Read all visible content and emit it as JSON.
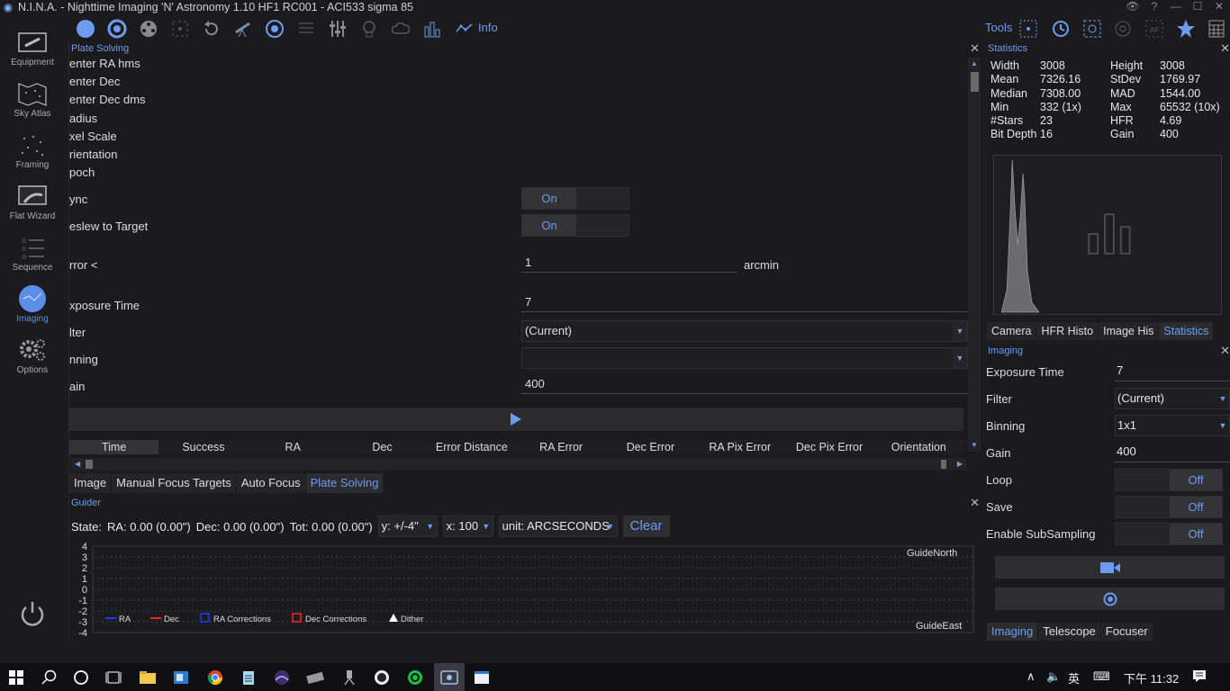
{
  "window": {
    "title": "N.I.N.A. - Nighttime Imaging 'N' Astronomy 1.10 HF1 RC001  -  ACI533 sigma 85"
  },
  "nav": {
    "items": [
      {
        "label": "Equipment"
      },
      {
        "label": "Sky Atlas"
      },
      {
        "label": "Framing"
      },
      {
        "label": "Flat Wizard"
      },
      {
        "label": "Sequence"
      },
      {
        "label": "Imaging"
      },
      {
        "label": "Options"
      }
    ],
    "active": "Imaging"
  },
  "toolbar": {
    "info_label": "Info",
    "tools_label": "Tools"
  },
  "plate_solving": {
    "header": "Plate Solving",
    "rows": {
      "center_ra": "enter RA hms",
      "center_dec": "enter Dec",
      "center_dec_dms": "enter Dec dms",
      "radius": "adius",
      "pixel_scale": "xel Scale",
      "orientation": "rientation",
      "epoch": "poch",
      "sync": "ync",
      "reslew": "eslew to Target",
      "error": "rror <",
      "exposure_time": "xposure Time",
      "filter": "lter",
      "binning": "nning",
      "gain": "ain"
    },
    "sync_state": "On",
    "reslew_state": "On",
    "error_value": "1",
    "error_unit": "arcmin",
    "exposure_value": "7",
    "filter_value": "(Current)",
    "binning_value": "",
    "gain_value": "400",
    "columns": [
      "Time",
      "Success",
      "RA",
      "Dec",
      "Error Distance",
      "RA Error",
      "Dec Error",
      "RA Pix Error",
      "Dec Pix Error",
      "Orientation"
    ]
  },
  "main_tabs": [
    {
      "label": "Image"
    },
    {
      "label": "Manual Focus Targets"
    },
    {
      "label": "Auto Focus"
    },
    {
      "label": "Plate Solving"
    }
  ],
  "guider": {
    "header": "Guider",
    "state_label": "State:",
    "ra_label": "RA: 0.00 (0.00\")",
    "dec_label": "Dec: 0.00 (0.00\")",
    "tot_label": "Tot: 0.00 (0.00\")",
    "y_select": "y: +/-4\"",
    "x_select": "x: 100",
    "unit_select": "unit: ARCSECONDS",
    "clear_label": "Clear",
    "y_ticks": [
      "4",
      "3",
      "2",
      "1",
      "0",
      "-1",
      "-2",
      "-3",
      "-4"
    ],
    "guide_north": "GuideNorth",
    "guide_east": "GuideEast",
    "legend": [
      {
        "label": "RA",
        "color": "#1e3cff"
      },
      {
        "label": "Dec",
        "color": "#ff2020"
      },
      {
        "label": "RA Corrections",
        "color": "#1e3cff"
      },
      {
        "label": "Dec Corrections",
        "color": "#ff2020"
      },
      {
        "label": "Dither",
        "color": "#ffffff"
      }
    ]
  },
  "statistics": {
    "header": "Statistics",
    "rows": [
      {
        "l1": "Width",
        "v1": "3008",
        "l2": "Height",
        "v2": "3008"
      },
      {
        "l1": "Mean",
        "v1": "7326.16",
        "l2": "StDev",
        "v2": "1769.97"
      },
      {
        "l1": "Median",
        "v1": "7308.00",
        "l2": "MAD",
        "v2": "1544.00"
      },
      {
        "l1": "Min",
        "v1": "332 (1x)",
        "l2": "Max",
        "v2": "65532 (10x)"
      },
      {
        "l1": "#Stars",
        "v1": "23",
        "l2": "HFR",
        "v2": "4.69"
      },
      {
        "l1": "Bit Depth",
        "v1": "16",
        "l2": "Gain",
        "v2": "400"
      }
    ],
    "tabs": [
      {
        "label": "Camera"
      },
      {
        "label": "HFR Histo"
      },
      {
        "label": "Image His"
      },
      {
        "label": "Statistics"
      }
    ]
  },
  "imaging": {
    "header": "Imaging",
    "exposure_label": "Exposure Time",
    "exposure_value": "7",
    "filter_label": "Filter",
    "filter_value": "(Current)",
    "binning_label": "Binning",
    "binning_value": "1x1",
    "gain_label": "Gain",
    "gain_value": "400",
    "loop_label": "Loop",
    "loop_state": "Off",
    "save_label": "Save",
    "save_state": "Off",
    "subsampling_label": "Enable SubSampling",
    "subsampling_state": "Off",
    "tabs": [
      {
        "label": "Imaging"
      },
      {
        "label": "Telescope"
      },
      {
        "label": "Focuser"
      }
    ]
  },
  "taskbar": {
    "ime": "英",
    "clock": "下午 11:32"
  },
  "colors": {
    "accent": "#6d9bf0",
    "background": "#1b1b1d"
  }
}
